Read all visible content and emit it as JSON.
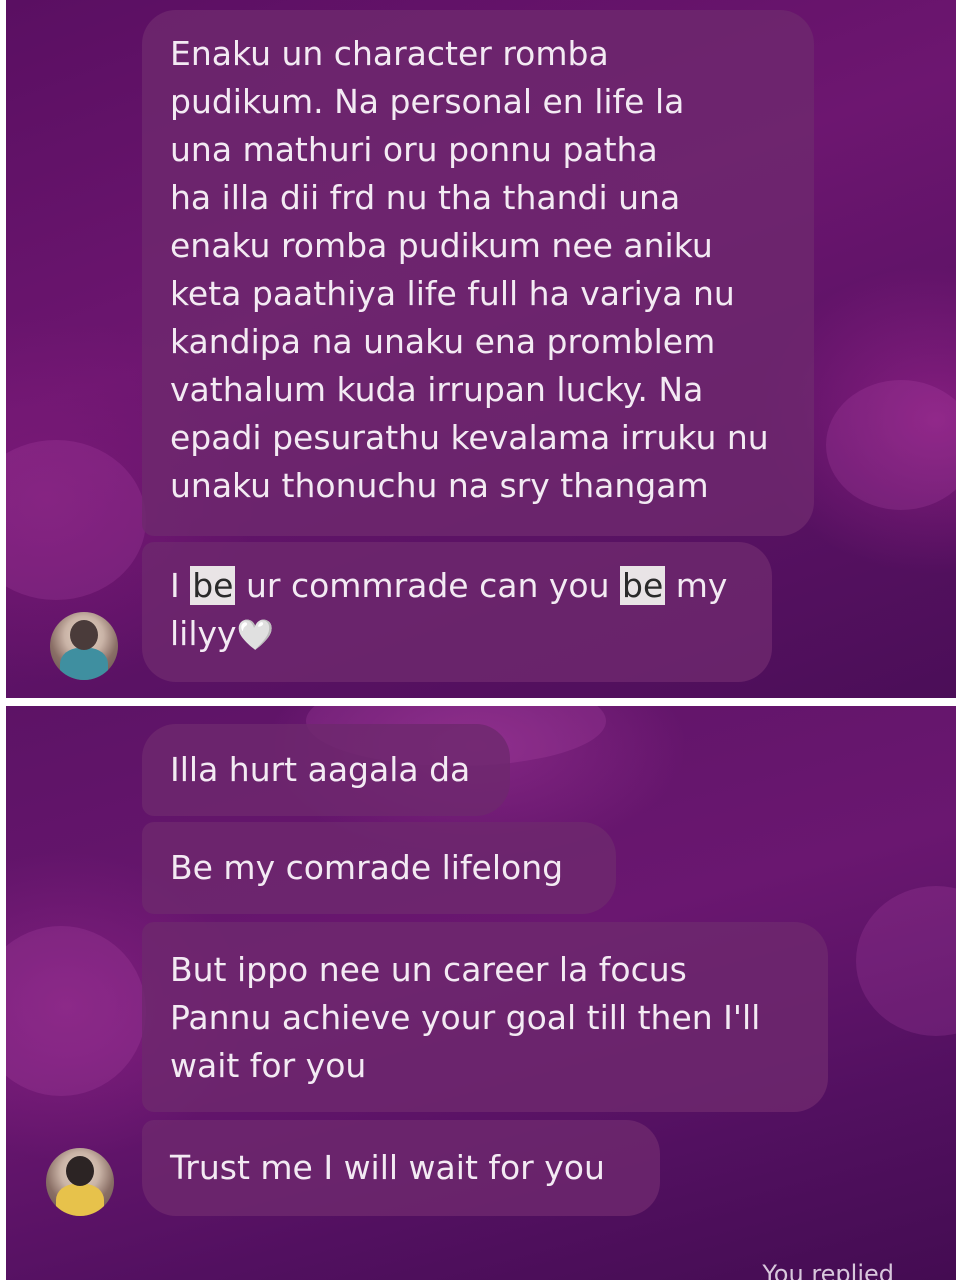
{
  "screenshot_top": {
    "message_1": "Enaku un character romba\npudikum. Na personal en life la\nuna mathuri oru ponnu patha\nha illa dii frd nu tha thandi una\nenaku romba pudikum nee aniku\nketa paathiya life full ha variya nu\nkandipa na unaku ena promblem\nvathalum kuda irrupan lucky. Na\nepadi pesurathu kevalama irruku nu\nunaku thonuchu na sry thangam",
    "message_2": {
      "part_1": "I ",
      "highlight_1": "be",
      "part_2": " ur commrade can you ",
      "highlight_2": "be",
      "part_3": " my",
      "line_2": "lilyy",
      "emoji": "🤍"
    }
  },
  "screenshot_bottom": {
    "message_1": "Illa hurt aagala da",
    "message_2": "Be my comrade lifelong",
    "message_3": "But ippo nee un career la focus\nPannu achieve your goal till then I'll\nwait for you",
    "message_4": "Trust me I will wait for you",
    "footer": "You replied"
  },
  "colors": {
    "background": "#621468",
    "bubble": "#6e286e",
    "text": "#f3eaf3",
    "highlight": "#e9e4e6"
  }
}
